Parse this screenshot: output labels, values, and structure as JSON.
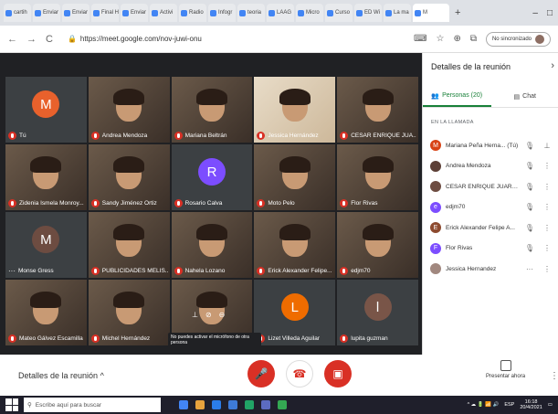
{
  "browser": {
    "tabs": [
      {
        "label": "cartih"
      },
      {
        "label": "Enviar"
      },
      {
        "label": "Enviar"
      },
      {
        "label": "Final H"
      },
      {
        "label": "Enviar"
      },
      {
        "label": "Activi"
      },
      {
        "label": "Radio"
      },
      {
        "label": "Infogr"
      },
      {
        "label": "teoria"
      },
      {
        "label": "LAAG"
      },
      {
        "label": "Micro"
      },
      {
        "label": "Curso"
      },
      {
        "label": "ED Wi"
      },
      {
        "label": "La ma"
      },
      {
        "label": "M"
      }
    ],
    "active_tab_icon": "M",
    "url": "https://meet.google.com/nov-juwi-onu",
    "signin_label": "No sincronizado"
  },
  "meeting": {
    "tiles": [
      {
        "name": "Tú",
        "type": "avatar",
        "letter": "M",
        "color": "#e8612c"
      },
      {
        "name": "Andrea Mendoza",
        "type": "video"
      },
      {
        "name": "Mariana Beltrán",
        "type": "video"
      },
      {
        "name": "Jessica Hernández",
        "type": "video",
        "pinned": true
      },
      {
        "name": "CESAR ENRIQUE JUA...",
        "type": "video"
      },
      {
        "name": "Zidenia Ismela Monroy...",
        "type": "video"
      },
      {
        "name": "Sandy Jiménez Ortiz",
        "type": "video"
      },
      {
        "name": "Rosario Calva",
        "type": "avatar",
        "letter": "R",
        "color": "#7c4dff"
      },
      {
        "name": "Moto Pelo",
        "type": "video"
      },
      {
        "name": "Flor Rivas",
        "type": "video"
      },
      {
        "name": "Monse Gress",
        "type": "avatar",
        "letter": "M",
        "color": "#6d4c41"
      },
      {
        "name": "PUBLICIDADES MELIS...",
        "type": "video"
      },
      {
        "name": "Nahela Lozano",
        "type": "video"
      },
      {
        "name": "Erick Alexander Felipe...",
        "type": "video"
      },
      {
        "name": "edjm70",
        "type": "video"
      },
      {
        "name": "Mateo Gálvez Escamilla",
        "type": "video"
      },
      {
        "name": "Michel Hernández",
        "type": "video"
      },
      {
        "name": "",
        "type": "video"
      },
      {
        "name": "Lizet Villeda Aguilar",
        "type": "avatar",
        "letter": "L",
        "color": "#ef6c00"
      },
      {
        "name": "lupita guzman",
        "type": "avatar",
        "letter": "l",
        "color": "#795548"
      }
    ],
    "tooltip": "No puedes activar el micrófono de otra persona"
  },
  "bottom": {
    "details_label": "Detalles de la reunión",
    "present_label": "Presentar ahora"
  },
  "panel": {
    "title": "Detalles de la reunión",
    "tab_people": "Personas (20)",
    "tab_chat": "Chat",
    "section_label": "EN LA LLAMADA",
    "participants": [
      {
        "name": "Mariana Peña Herna... (Tú)",
        "letter": "M",
        "color": "#d84315"
      },
      {
        "name": "Andrea Mendoza",
        "letter": "",
        "color": "#5d4037"
      },
      {
        "name": "CESAR ENRIQUE JUARE...",
        "letter": "",
        "color": "#6d4c41"
      },
      {
        "name": "edjm70",
        "letter": "e",
        "color": "#7c4dff"
      },
      {
        "name": "Erick Alexander Felipe A...",
        "letter": "E",
        "color": "#8d4a2f"
      },
      {
        "name": "Flor Rivas",
        "letter": "F",
        "color": "#7c4dff"
      },
      {
        "name": "Jessica Hernandez",
        "letter": "",
        "color": "#a1887f"
      }
    ]
  },
  "taskbar": {
    "search_placeholder": "Escribe aquí para buscar",
    "time": "16:18",
    "date": "20/4/2021",
    "lang": "ESP"
  }
}
